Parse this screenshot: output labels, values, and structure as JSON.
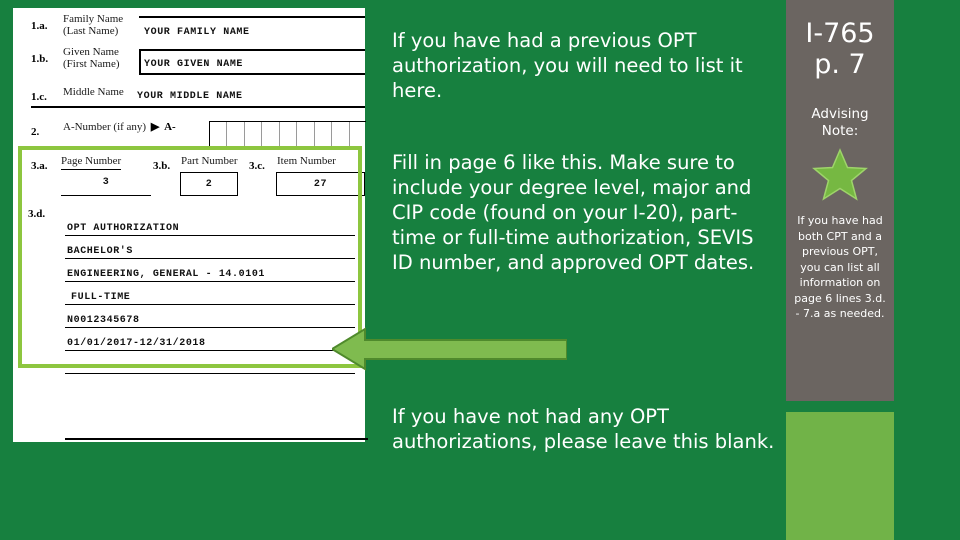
{
  "colors": {
    "background_green": "#17803f",
    "highlight_border_green": "#8dc63f",
    "arrow_green": "#7fbb4f",
    "arrow_outline_green": "#4f8a2c",
    "side_panel_gray": "#6b6561",
    "accent_rect_green": "#71b348",
    "form_white": "#ffffff",
    "text_white": "#ffffff",
    "ink_black": "#111111"
  },
  "form": {
    "title": "I-765 form excerpt",
    "name_rows": [
      {
        "num": "1.a.",
        "label_line1": "Family Name",
        "label_line2": "(Last Name)",
        "value": "YOUR FAMILY NAME"
      },
      {
        "num": "1.b.",
        "label_line1": "Given Name",
        "label_line2": "(First Name)",
        "value": "YOUR GIVEN NAME"
      },
      {
        "num": "1.c.",
        "label_line1": "Middle Name",
        "label_line2": "",
        "value": "YOUR MIDDLE NAME"
      }
    ],
    "anumber": {
      "num": "2.",
      "label": "A-Number (if any)",
      "arrow_glyph": "▶",
      "prefix": "A-",
      "cell_count": 9
    },
    "numbered_fields": [
      {
        "num": "3.a.",
        "label": "Page Number",
        "value": "3",
        "style": "underline"
      },
      {
        "num": "3.b.",
        "label": "Part Number",
        "value": "2",
        "style": "box"
      },
      {
        "num": "3.c.",
        "label": "Item Number",
        "value": "27",
        "style": "box"
      }
    ],
    "detail_section": {
      "num": "3.d.",
      "lines": [
        "OPT AUTHORIZATION",
        "BACHELOR'S",
        "ENGINEERING, GENERAL - 14.0101",
        "FULL-TIME",
        "N0012345678",
        "01/01/2017-12/31/2018",
        ""
      ]
    }
  },
  "annotations": {
    "block1": "If you have had a previous OPT authorization, you will need to list it here.",
    "block2": "Fill in page 6 like this.  Make sure to include your degree level, major and CIP code (found on your I-20), part-time or full-time authorization, SEVIS ID number,  and approved OPT dates.",
    "block3": "If you have not had any OPT authorizations, please leave this blank."
  },
  "side_panel": {
    "title_line1": "I-765",
    "title_line2": "p. 7",
    "note_label_line1": "Advising",
    "note_label_line2": "Note:",
    "star_icon": "star-icon",
    "note_body": "If you have had both CPT and a previous OPT, you can list all information on page 6 lines 3.d. - 7.a as needed."
  }
}
